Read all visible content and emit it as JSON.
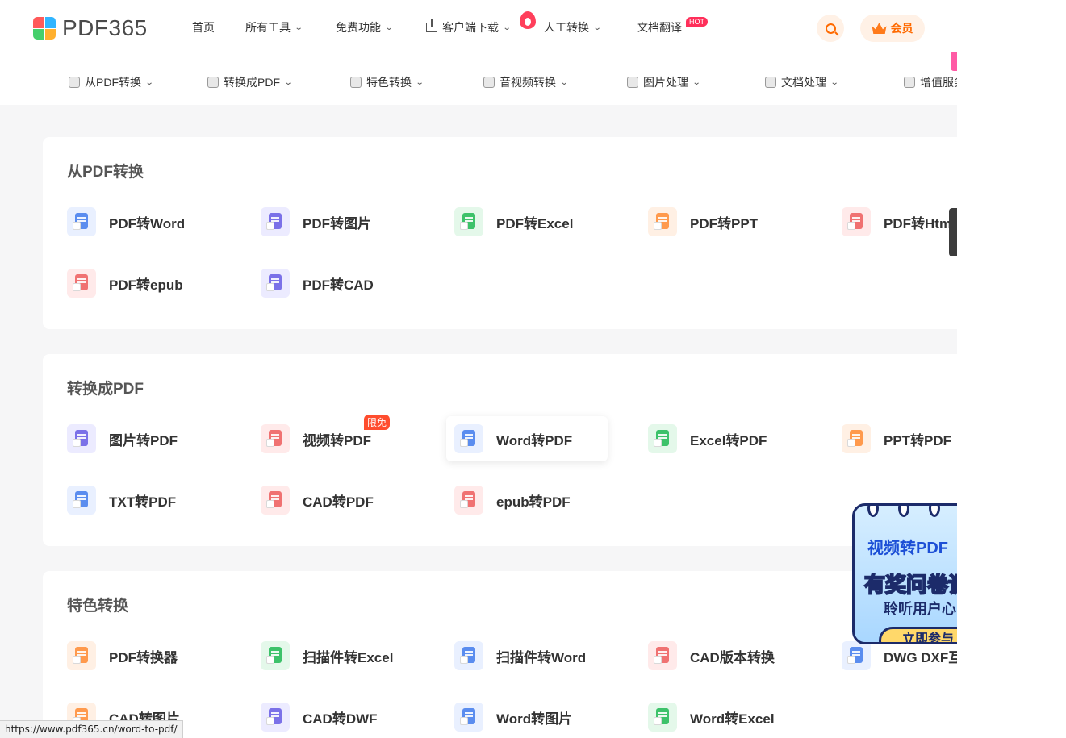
{
  "header": {
    "logo_text": "PDF365",
    "nav": [
      {
        "label": "首页",
        "has_chevron": false
      },
      {
        "label": "所有工具",
        "has_chevron": true
      },
      {
        "label": "免费功能",
        "has_chevron": true
      },
      {
        "label": "客户端下载",
        "has_chevron": true
      },
      {
        "label": "人工转换",
        "has_chevron": true
      },
      {
        "label": "文档翻译",
        "has_chevron": false
      }
    ],
    "hot_badge": "HOT",
    "vip_label": "会员"
  },
  "subnav": [
    {
      "label": "从PDF转换"
    },
    {
      "label": "转换成PDF"
    },
    {
      "label": "特色转换"
    },
    {
      "label": "音视频转换"
    },
    {
      "label": "图片处理"
    },
    {
      "label": "文档处理"
    },
    {
      "label": "增值服务"
    }
  ],
  "sections": [
    {
      "title": "从PDF转换",
      "tools": [
        {
          "label": "PDF转Word",
          "color": "blue"
        },
        {
          "label": "PDF转图片",
          "color": "purple"
        },
        {
          "label": "PDF转Excel",
          "color": "green"
        },
        {
          "label": "PDF转PPT",
          "color": "orange"
        },
        {
          "label": "PDF转Html",
          "color": "red"
        },
        {
          "label": "PDF转epub",
          "color": "red"
        },
        {
          "label": "PDF转CAD",
          "color": "purple"
        }
      ]
    },
    {
      "title": "转换成PDF",
      "tools": [
        {
          "label": "图片转PDF",
          "color": "purple"
        },
        {
          "label": "视频转PDF",
          "color": "red",
          "badge": "限免"
        },
        {
          "label": "Word转PDF",
          "color": "blue",
          "highlighted": true
        },
        {
          "label": "Excel转PDF",
          "color": "green"
        },
        {
          "label": "PPT转PDF",
          "color": "orange"
        },
        {
          "label": "TXT转PDF",
          "color": "blue"
        },
        {
          "label": "CAD转PDF",
          "color": "red"
        },
        {
          "label": "epub转PDF",
          "color": "red"
        }
      ]
    },
    {
      "title": "特色转换",
      "tools": [
        {
          "label": "PDF转换器",
          "color": "orange"
        },
        {
          "label": "扫描件转Excel",
          "color": "green"
        },
        {
          "label": "扫描件转Word",
          "color": "blue"
        },
        {
          "label": "CAD版本转换",
          "color": "red"
        },
        {
          "label": "DWG DXF互",
          "color": "blue"
        },
        {
          "label": "CAD转图片",
          "color": "orange"
        },
        {
          "label": "CAD转DWF",
          "color": "purple"
        },
        {
          "label": "Word转图片",
          "color": "blue"
        },
        {
          "label": "Word转Excel",
          "color": "green"
        }
      ]
    }
  ],
  "promo": {
    "line1": "视频转PDF",
    "line2": "有奖问卷调",
    "line3": "聆听用户心",
    "button": "立即参与"
  },
  "status_url": "https://www.pdf365.cn/word-to-pdf/"
}
